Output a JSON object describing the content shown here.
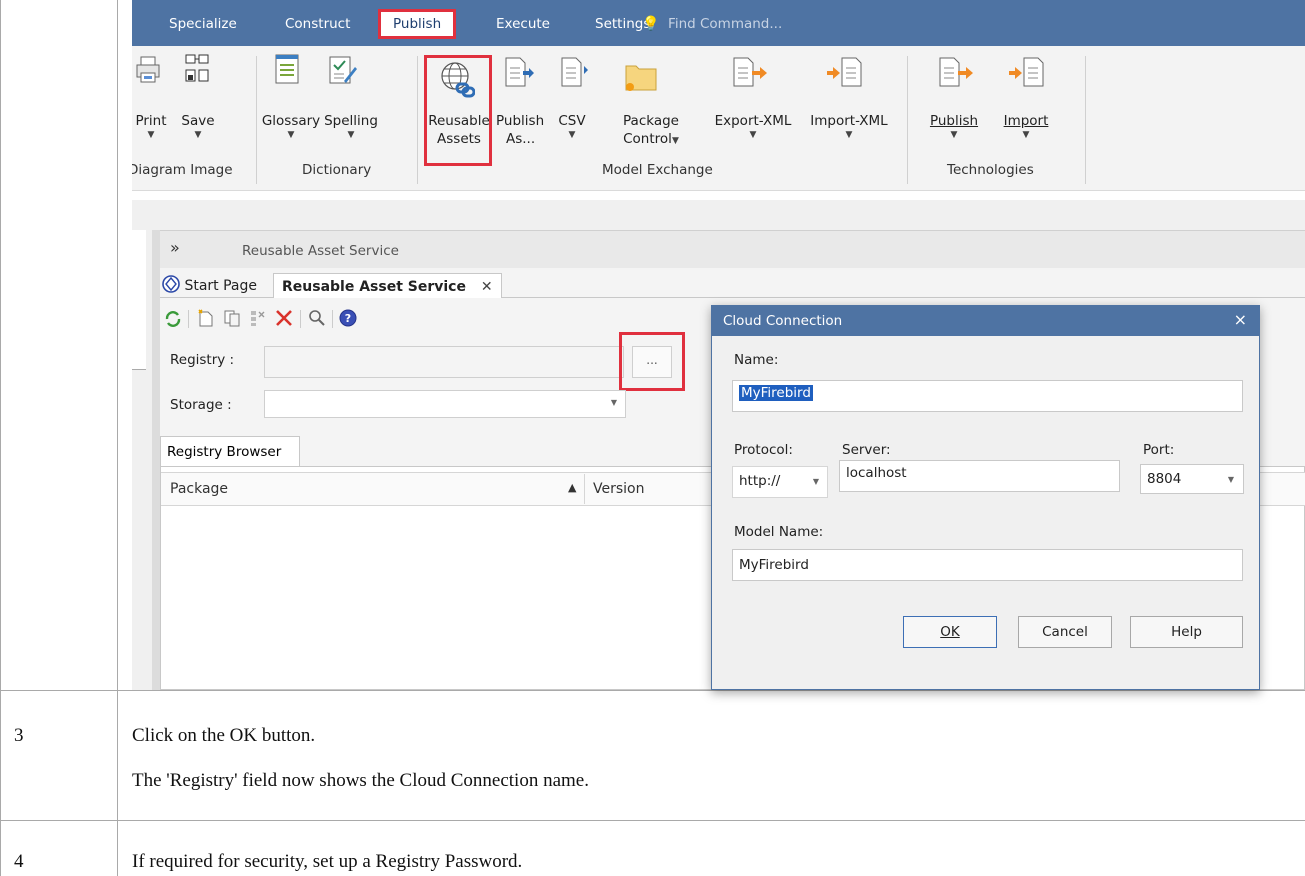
{
  "ribbon": {
    "tabs": [
      "Specialize",
      "Construct",
      "Publish",
      "Execute",
      "Settings"
    ],
    "active_tab": "Publish",
    "find_command": "Find Command...",
    "buttons": {
      "print": "Print",
      "save": "Save",
      "glossary": "Glossary",
      "spelling": "Spelling",
      "reusable_assets_1": "Reusable",
      "reusable_assets_2": "Assets",
      "publish_as_1": "Publish",
      "publish_as_2": "As...",
      "csv": "CSV",
      "package_control_1": "Package",
      "package_control_2": "Control",
      "export_xml": "Export-XML",
      "import_xml": "Import-XML",
      "publish": "Publish",
      "import": "Import"
    },
    "groups": {
      "diagram_image": "Diagram Image",
      "dictionary": "Dictionary",
      "model_exchange": "Model Exchange",
      "technologies": "Technologies"
    }
  },
  "dock": {
    "collapse_glyph": "»",
    "title": "Reusable Asset Service",
    "tabs": {
      "start_page": "Start Page",
      "reusable_asset_service": "Reusable Asset Service"
    },
    "close_glyph": "✕"
  },
  "panel": {
    "registry_label": "Registry :",
    "storage_label": "Storage :",
    "browse_button": "...",
    "registry_browser_tab": "Registry Browser",
    "columns": {
      "package": "Package",
      "version": "Version"
    }
  },
  "dialog": {
    "title": "Cloud Connection",
    "close_glyph": "×",
    "name_label": "Name:",
    "name_value": "MyFirebird",
    "protocol_label": "Protocol:",
    "protocol_value": "http://",
    "server_label": "Server:",
    "server_value": "localhost",
    "port_label": "Port:",
    "port_value": "8804",
    "model_name_label": "Model Name:",
    "model_name_value": "MyFirebird",
    "ok": "OK",
    "cancel": "Cancel",
    "help": "Help"
  },
  "steps": [
    {
      "num": "3",
      "line1": "Click on the OK button.",
      "line2": "The 'Registry' field now shows the Cloud Connection name."
    },
    {
      "num": "4",
      "line1": "If required for security, set up a Registry Password."
    }
  ],
  "colors": {
    "ribbon_blue": "#4e73a3",
    "highlight_red": "#e0303e"
  }
}
